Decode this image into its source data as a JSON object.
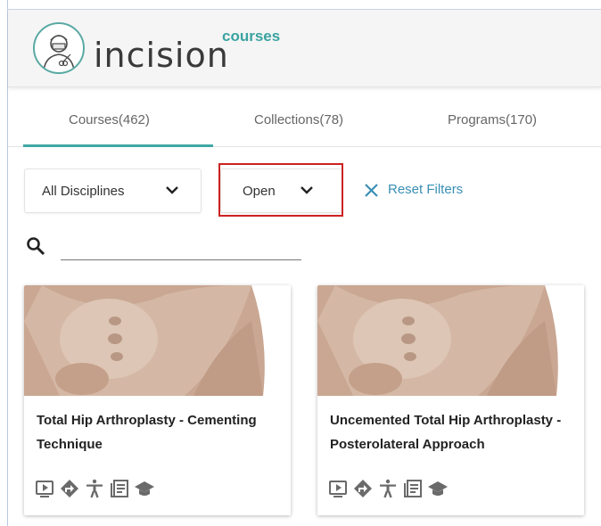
{
  "brand": {
    "name": "incision",
    "sub": "courses"
  },
  "tabs": [
    {
      "label": "Courses(462)",
      "active": true
    },
    {
      "label": "Collections(78)",
      "active": false
    },
    {
      "label": "Programs(170)",
      "active": false
    }
  ],
  "filters": {
    "discipline": "All Disciplines",
    "access": "Open",
    "reset_label": "Reset Filters"
  },
  "search": {
    "value": "",
    "placeholder": ""
  },
  "cards": [
    {
      "title": "Total Hip Arthroplasty - Cementing Technique",
      "icons": [
        "video-icon",
        "route-icon",
        "accessibility-icon",
        "document-icon",
        "graduation-cap-icon"
      ]
    },
    {
      "title": "Uncemented Total Hip Arthroplasty - Posterolateral Approach",
      "icons": [
        "video-icon",
        "route-icon",
        "accessibility-icon",
        "document-icon",
        "graduation-cap-icon"
      ]
    }
  ],
  "colors": {
    "accent": "#3fa8a4",
    "link": "#3a8fb5",
    "highlight": "#cc2222",
    "icon_gray": "#6a6a6a"
  }
}
